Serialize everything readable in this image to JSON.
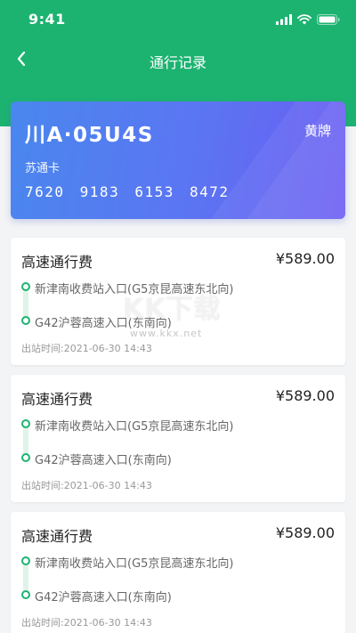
{
  "status": {
    "time": "9:41"
  },
  "nav": {
    "title": "通行记录"
  },
  "plate": {
    "number": "川A·05U4S",
    "type": "黄牌",
    "card_name": "苏通卡",
    "card_number": "7620 9183 6153 8472"
  },
  "records": [
    {
      "title": "高速通行费",
      "amount": "¥589.00",
      "entry": "新津南收费站入口(G5京昆高速东北向)",
      "exit": "G42沪蓉高速入口(东南向)",
      "exit_time": "出站时间:2021-06-30 14:43"
    },
    {
      "title": "高速通行费",
      "amount": "¥589.00",
      "entry": "新津南收费站入口(G5京昆高速东北向)",
      "exit": "G42沪蓉高速入口(东南向)",
      "exit_time": "出站时间:2021-06-30 14:43"
    },
    {
      "title": "高速通行费",
      "amount": "¥589.00",
      "entry": "新津南收费站入口(G5京昆高速东北向)",
      "exit": "G42沪蓉高速入口(东南向)",
      "exit_time": "出站时间:2021-06-30 14:43"
    }
  ],
  "watermark": {
    "big": "KK下载",
    "small": "www.kkx.net"
  },
  "colors": {
    "header": "#1cb371",
    "card_start": "#4a87ee",
    "card_end": "#6b5cf4"
  }
}
